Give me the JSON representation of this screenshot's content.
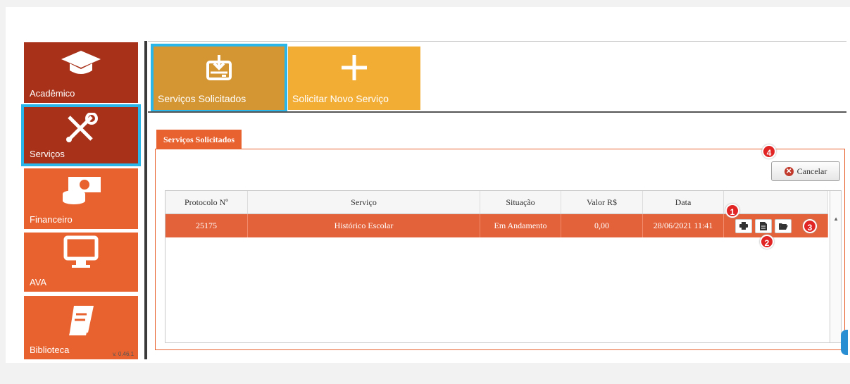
{
  "sidebar": {
    "items": [
      {
        "label": "Acadêmico",
        "icon": "graduation-cap-icon"
      },
      {
        "label": "Serviços",
        "icon": "tools-icon"
      },
      {
        "label": "Financeiro",
        "icon": "money-icon"
      },
      {
        "label": "AVA",
        "icon": "monitor-icon"
      },
      {
        "label": "Biblioteca",
        "icon": "book-icon"
      }
    ],
    "version": "v. 0.46.1"
  },
  "top_tiles": {
    "services": {
      "label": "Serviços Solicitados",
      "icon": "inbox-download-icon"
    },
    "new_service": {
      "label": "Solicitar Novo Serviço",
      "icon": "plus-icon"
    }
  },
  "panel": {
    "tab_label": "Serviços Solicitados",
    "cancel_label": "Cancelar"
  },
  "table": {
    "headers": [
      "Protocolo Nº",
      "Serviço",
      "Situação",
      "Valor R$",
      "Data",
      ""
    ],
    "rows": [
      {
        "protocolo": "25175",
        "servico": "Histórico Escolar",
        "situacao": "Em Andamento",
        "valor": "0,00",
        "data": "28/06/2021 11:41"
      }
    ]
  },
  "markers": [
    "1",
    "2",
    "3",
    "4"
  ],
  "colors": {
    "accent_dark": "#a8311a",
    "accent_orange": "#e8622f",
    "tile_gold": "#d39632",
    "tile_yellow": "#f2ad35",
    "selection_blue": "#2ab6e8",
    "marker_red": "#e12424"
  }
}
